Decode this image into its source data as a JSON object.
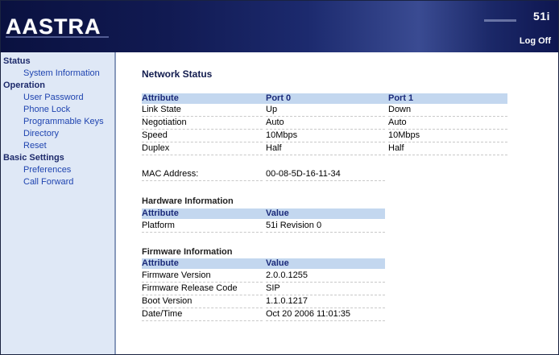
{
  "header": {
    "logo_text": "AASTRA",
    "model": "51i",
    "logoff_label": "Log Off"
  },
  "sidebar": {
    "sections": [
      {
        "label": "Status",
        "items": [
          "System Information"
        ]
      },
      {
        "label": "Operation",
        "items": [
          "User Password",
          "Phone Lock",
          "Programmable Keys",
          "Directory",
          "Reset"
        ]
      },
      {
        "label": "Basic Settings",
        "items": [
          "Preferences",
          "Call Forward"
        ]
      }
    ]
  },
  "main": {
    "title": "Network Status",
    "network": {
      "headers": [
        "Attribute",
        "Port 0",
        "Port 1"
      ],
      "rows": [
        [
          "Link State",
          "Up",
          "Down"
        ],
        [
          "Negotiation",
          "Auto",
          "Auto"
        ],
        [
          "Speed",
          "10Mbps",
          "10Mbps"
        ],
        [
          "Duplex",
          "Half",
          "Half"
        ]
      ]
    },
    "mac": {
      "label": "MAC Address:",
      "value": "00-08-5D-16-11-34"
    },
    "hardware": {
      "title": "Hardware Information",
      "headers": [
        "Attribute",
        "Value"
      ],
      "rows": [
        [
          "Platform",
          "51i Revision 0"
        ]
      ]
    },
    "firmware": {
      "title": "Firmware Information",
      "headers": [
        "Attribute",
        "Value"
      ],
      "rows": [
        [
          "Firmware Version",
          "2.0.0.1255"
        ],
        [
          "Firmware Release Code",
          "SIP"
        ],
        [
          "Boot Version",
          "1.1.0.1217"
        ],
        [
          "Date/Time",
          "Oct 20 2006 11:01:35"
        ]
      ]
    }
  }
}
